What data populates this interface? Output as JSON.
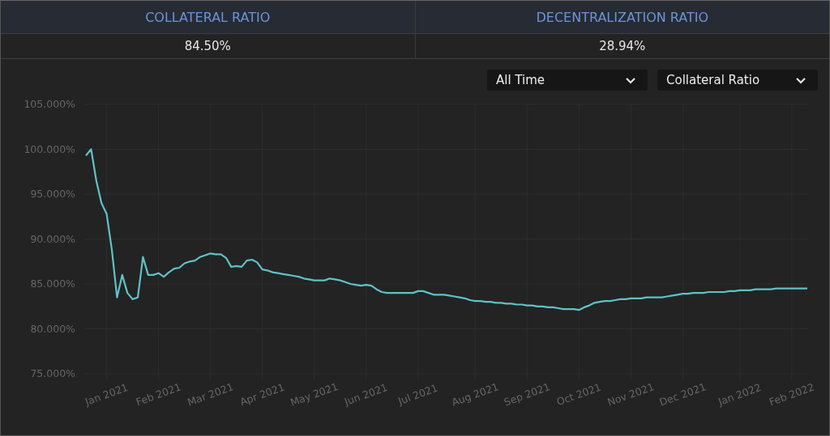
{
  "stats": [
    {
      "label": "COLLATERAL RATIO",
      "value": "84.50%"
    },
    {
      "label": "DECENTRALIZATION RATIO",
      "value": "28.94%"
    }
  ],
  "dropdowns": [
    {
      "value": "All Time"
    },
    {
      "value": "Collateral Ratio"
    }
  ],
  "chart": {
    "chart_data": {
      "type": "line",
      "ylim": [
        75,
        105
      ],
      "yticks": [
        {
          "value": 75,
          "label": "75.000%"
        },
        {
          "value": 80,
          "label": "80.000%"
        },
        {
          "value": 85,
          "label": "85.000%"
        },
        {
          "value": 90,
          "label": "90.000%"
        },
        {
          "value": 95,
          "label": "95.000%"
        },
        {
          "value": 100,
          "label": "100.000%"
        },
        {
          "value": 105,
          "label": "105.000%"
        }
      ],
      "categories": [
        null,
        null,
        null,
        null,
        "Jan 2021",
        null,
        null,
        null,
        null,
        null,
        null,
        null,
        null,
        null,
        "Feb 2021",
        null,
        null,
        null,
        null,
        null,
        null,
        null,
        null,
        null,
        "Mar 2021",
        null,
        null,
        null,
        null,
        null,
        null,
        null,
        null,
        null,
        "Apr 2021",
        null,
        null,
        null,
        null,
        null,
        null,
        null,
        null,
        null,
        "May 2021",
        null,
        null,
        null,
        null,
        null,
        null,
        null,
        null,
        null,
        "Jun 2021",
        null,
        null,
        null,
        null,
        null,
        null,
        null,
        null,
        null,
        "Jul 2021",
        null,
        null,
        null,
        null,
        null,
        null,
        null,
        null,
        null,
        null,
        "Aug 2021",
        null,
        null,
        null,
        null,
        null,
        null,
        null,
        null,
        null,
        "Sep 2021",
        null,
        null,
        null,
        null,
        null,
        null,
        null,
        null,
        null,
        "Oct 2021",
        null,
        null,
        null,
        null,
        null,
        null,
        null,
        null,
        null,
        "Nov 2021",
        null,
        null,
        null,
        null,
        null,
        null,
        null,
        null,
        null,
        "Dec 2021",
        null,
        null,
        null,
        null,
        null,
        null,
        null,
        null,
        null,
        null,
        "Jan 2022",
        null,
        null,
        null,
        null,
        null,
        null,
        null,
        null,
        null,
        "Feb 2022",
        null,
        null,
        null
      ],
      "series": [
        {
          "color": "#5fc2c6",
          "values": [
            99.3,
            100,
            96.5,
            94,
            92.8,
            88.8,
            83.5,
            86,
            84,
            83.3,
            83.5,
            88,
            86,
            86,
            86.2,
            85.8,
            86.3,
            86.7,
            86.8,
            87.3,
            87.5,
            87.6,
            88,
            88.2,
            88.4,
            88.3,
            88.3,
            87.9,
            86.9,
            87,
            86.9,
            87.6,
            87.7,
            87.4,
            86.6,
            86.5,
            86.3,
            86.2,
            86.1,
            86,
            85.9,
            85.8,
            85.6,
            85.5,
            85.4,
            85.4,
            85.4,
            85.6,
            85.5,
            85.4,
            85.2,
            85,
            84.9,
            84.8,
            84.9,
            84.8,
            84.4,
            84.1,
            84,
            84,
            84,
            84,
            84,
            84,
            84.2,
            84.2,
            84,
            83.8,
            83.8,
            83.8,
            83.7,
            83.6,
            83.5,
            83.4,
            83.2,
            83.1,
            83.1,
            83,
            83,
            82.9,
            82.9,
            82.8,
            82.8,
            82.7,
            82.7,
            82.6,
            82.6,
            82.5,
            82.5,
            82.4,
            82.4,
            82.3,
            82.2,
            82.2,
            82.2,
            82.1,
            82.4,
            82.6,
            82.9,
            83,
            83.1,
            83.1,
            83.2,
            83.3,
            83.3,
            83.4,
            83.4,
            83.4,
            83.5,
            83.5,
            83.5,
            83.5,
            83.6,
            83.7,
            83.8,
            83.9,
            83.9,
            84,
            84,
            84,
            84.1,
            84.1,
            84.1,
            84.1,
            84.2,
            84.2,
            84.3,
            84.3,
            84.3,
            84.4,
            84.4,
            84.4,
            84.4,
            84.5,
            84.5,
            84.5,
            84.5,
            84.5,
            84.5,
            84.5
          ]
        }
      ],
      "grid": true
    }
  }
}
